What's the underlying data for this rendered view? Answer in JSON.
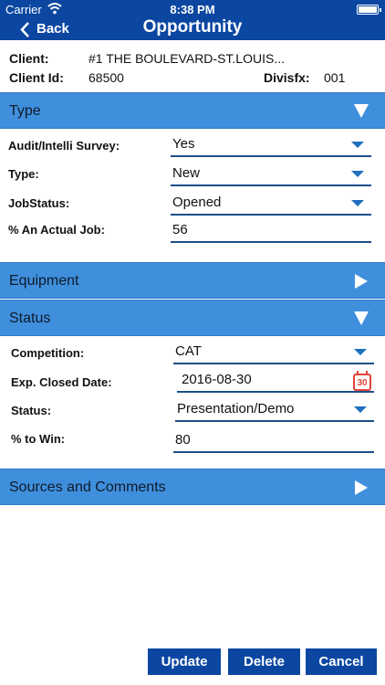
{
  "status_bar": {
    "carrier": "Carrier",
    "time": "8:38 PM"
  },
  "nav": {
    "back_label": "Back",
    "title": "Opportunity"
  },
  "client": {
    "client_label": "Client:",
    "client_value": "#1 THE BOULEVARD-ST.LOUIS...",
    "client_id_label": "Client Id:",
    "client_id_value": "68500",
    "divisfx_label": "Divisfx:",
    "divisfx_value": "001"
  },
  "sections": {
    "type": "Type",
    "equipment": "Equipment",
    "status": "Status",
    "sources": "Sources and Comments"
  },
  "type_fields": {
    "audit_label": "Audit/Intelli Survey:",
    "audit_value": "Yes",
    "type_label": "Type:",
    "type_value": "New",
    "jobstatus_label": "JobStatus:",
    "jobstatus_value": "Opened",
    "actual_job_label": "% An Actual Job:",
    "actual_job_value": "56"
  },
  "status_fields": {
    "competition_label": "Competition:",
    "competition_value": "CAT",
    "closed_date_label": "Exp. Closed Date:",
    "closed_date_value": "2016-08-30",
    "calendar_day": "30",
    "status_label": "Status:",
    "status_value": "Presentation/Demo",
    "to_win_label": "% to Win:",
    "to_win_value": "80"
  },
  "actions": {
    "update": "Update",
    "delete": "Delete",
    "cancel": "Cancel"
  },
  "colors": {
    "nav_bar": "#0b47a1",
    "section_header": "#3f8fdd",
    "accent": "#1e6fbf",
    "calendar_icon": "#e0443a"
  }
}
